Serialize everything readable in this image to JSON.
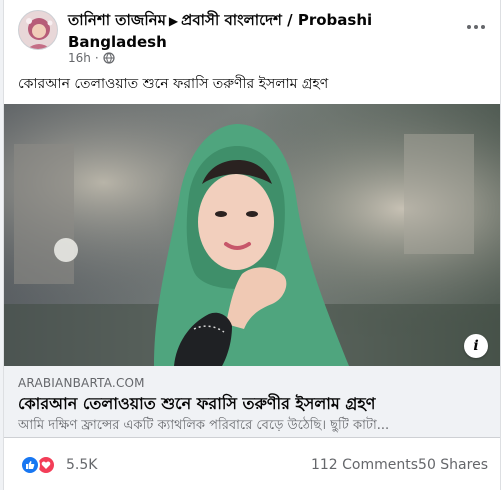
{
  "post": {
    "author": "তানিশা তাজনিম",
    "group": "প্রবাসী বাংলাদেশ / Probashi Bangladesh",
    "time": "16h",
    "privacy_icon": "globe-icon",
    "more_icon": "more-options-icon",
    "text": "কোরআন তেলাওয়াত শুনে ফরাসি তরুণীর ইসলাম গ্রহণ"
  },
  "link_preview": {
    "domain": "ARABIANBARTA.COM",
    "title": "কোরআন তেলাওয়াত শুনে ফরাসি তরুণীর ইসলাম গ্রহণ",
    "description": "আমি দক্ষিণ ফ্রান্সের একটি ক্যাথলিক পরিবারে বেড়ে উঠেছি। ছুটি কাটা...",
    "info_icon": "info-icon"
  },
  "engagement": {
    "reactions": [
      "like-icon",
      "love-icon"
    ],
    "reaction_count": "5.5K",
    "comments": "112 Comments",
    "shares": "50 Shares"
  },
  "colors": {
    "like": "#1877f2",
    "love": "#f33e58",
    "hijab": "#4fa57e",
    "secondary_text": "#65676b"
  }
}
